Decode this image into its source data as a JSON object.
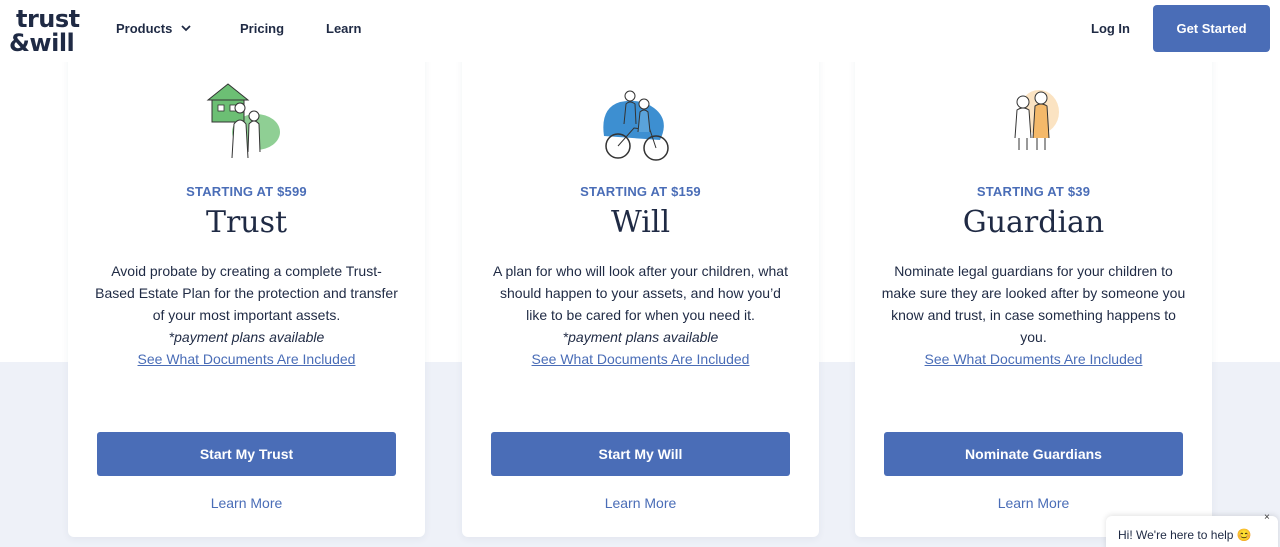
{
  "header": {
    "logo_line1": "trust",
    "logo_line2": "&will",
    "nav": {
      "products": "Products",
      "pricing": "Pricing",
      "learn": "Learn"
    },
    "login": "Log In",
    "get_started": "Get Started"
  },
  "cards": [
    {
      "price": "STARTING AT $599",
      "title": "Trust",
      "description": "Avoid probate by creating a complete Trust-Based Estate Plan for the protection and transfer of your most important assets.",
      "payment_note": "*payment plans available",
      "docs_link": "See What Documents Are Included",
      "cta": "Start My Trust",
      "learn_more": "Learn More"
    },
    {
      "price": "STARTING AT $159",
      "title": "Will",
      "description": "A plan for who will look after your children, what should happen to your assets, and how you’d like to be cared for when you need it.",
      "payment_note": "*payment plans available",
      "docs_link": "See What Documents Are Included",
      "cta": "Start My Will",
      "learn_more": "Learn More"
    },
    {
      "price": "STARTING AT $39",
      "title": "Guardian",
      "description": "Nominate legal guardians for your children to make sure they are looked after by someone you know and trust, in case something happens to you.",
      "docs_link": "See What Documents Are Included",
      "cta": "Nominate Guardians",
      "learn_more": "Learn More"
    }
  ],
  "chat": {
    "text": "Hi! We're here to help 😊",
    "close": "×"
  },
  "colors": {
    "brand": "#4a6db7",
    "navy": "#1f2a44",
    "band": "#eef1f8"
  }
}
